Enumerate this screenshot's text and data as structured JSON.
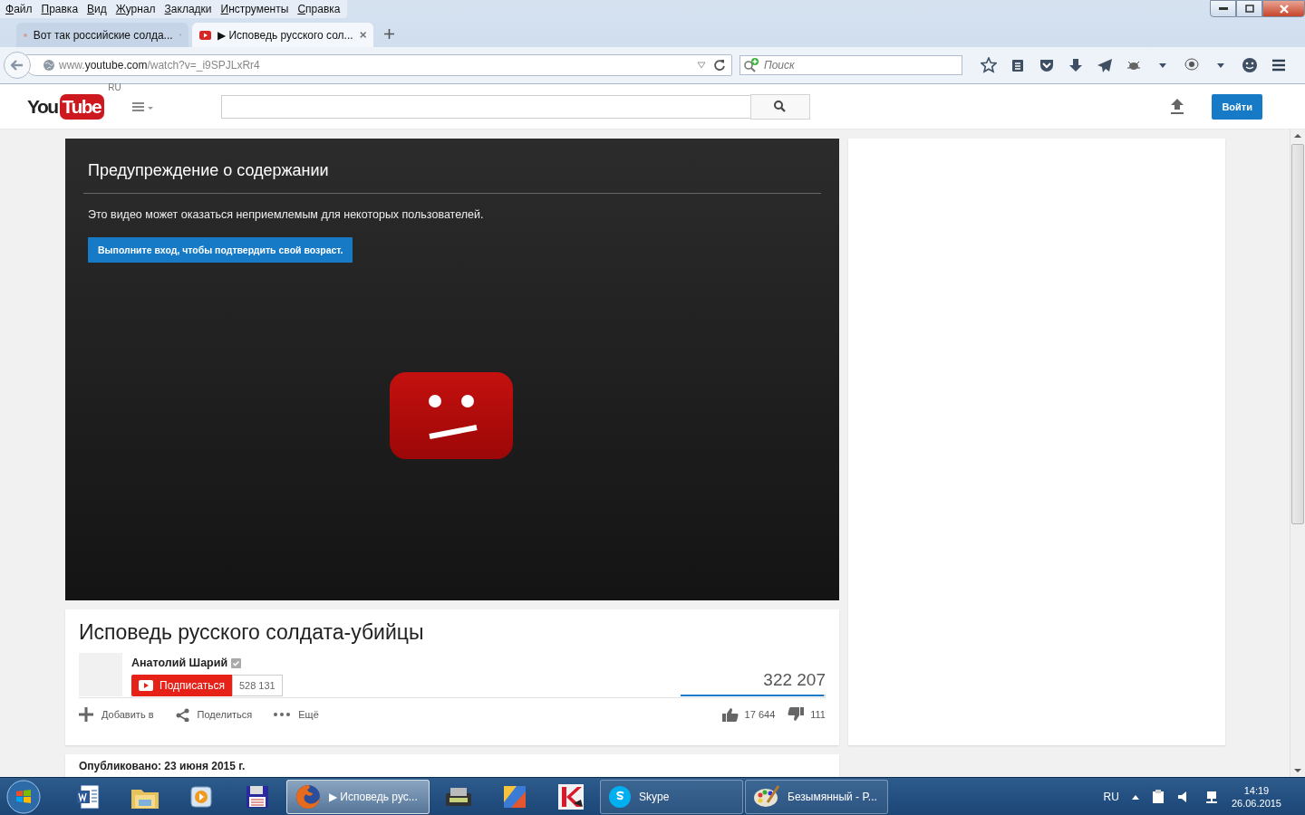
{
  "menu_bar": [
    "Файл",
    "Правка",
    "Вид",
    "Журнал",
    "Закладки",
    "Инструменты",
    "Справка"
  ],
  "tabs": [
    {
      "kind": "site",
      "label": "Вот так российские солда...",
      "selected": false
    },
    {
      "kind": "video",
      "label": "▶ Исповедь русского сол...",
      "selected": true
    }
  ],
  "address_bar": {
    "url_prefix": "www.",
    "url_domain": "youtube.com",
    "url_path": "/watch?v=_i9SPJLxRr4"
  },
  "search_field": {
    "placeholder": "Поиск"
  },
  "site_header": {
    "logo_you": "You",
    "logo_tube": "Tube",
    "region": "RU",
    "sign_in": "Войти"
  },
  "player": {
    "warning_title": "Предупреждение о содержании",
    "warning_text": "Это видео может оказаться неприемлемым для некоторых пользователей.",
    "sign_in_button": "Выполните вход, чтобы подтвердить свой возраст."
  },
  "video": {
    "title": "Исповедь русского солдата-убийцы",
    "channel": "Анатолий Шарий",
    "verified": true,
    "subscribe": "Подписаться",
    "subscribers": "528 131",
    "views": "322 207",
    "like_ratio": {
      "level": 0.99
    },
    "actions": [
      {
        "kind": "add",
        "label": "Добавить в"
      },
      {
        "kind": "share",
        "label": "Поделиться"
      },
      {
        "kind": "more",
        "label": "Ещё"
      }
    ],
    "likes": "17 644",
    "dislikes": "111"
  },
  "description": {
    "published": "Опубликовано: 23 июня 2015 г."
  },
  "taskbar": {
    "items": [
      {
        "kind": "word",
        "selected": false
      },
      {
        "kind": "explorer",
        "selected": false
      },
      {
        "kind": "media",
        "selected": false
      },
      {
        "kind": "save",
        "selected": false
      },
      {
        "kind": "firefox",
        "label": "▶ Исповедь рус...",
        "selected": true
      },
      {
        "kind": "device",
        "selected": false
      },
      {
        "kind": "photos",
        "selected": false
      },
      {
        "kind": "antivirus",
        "selected": false
      },
      {
        "kind": "skype",
        "label": "Skype",
        "selected": false
      },
      {
        "kind": "paint",
        "label": "Безымянный - P...",
        "selected": false
      }
    ],
    "language": "RU",
    "time": "14:19",
    "date": "26.06.2015"
  }
}
